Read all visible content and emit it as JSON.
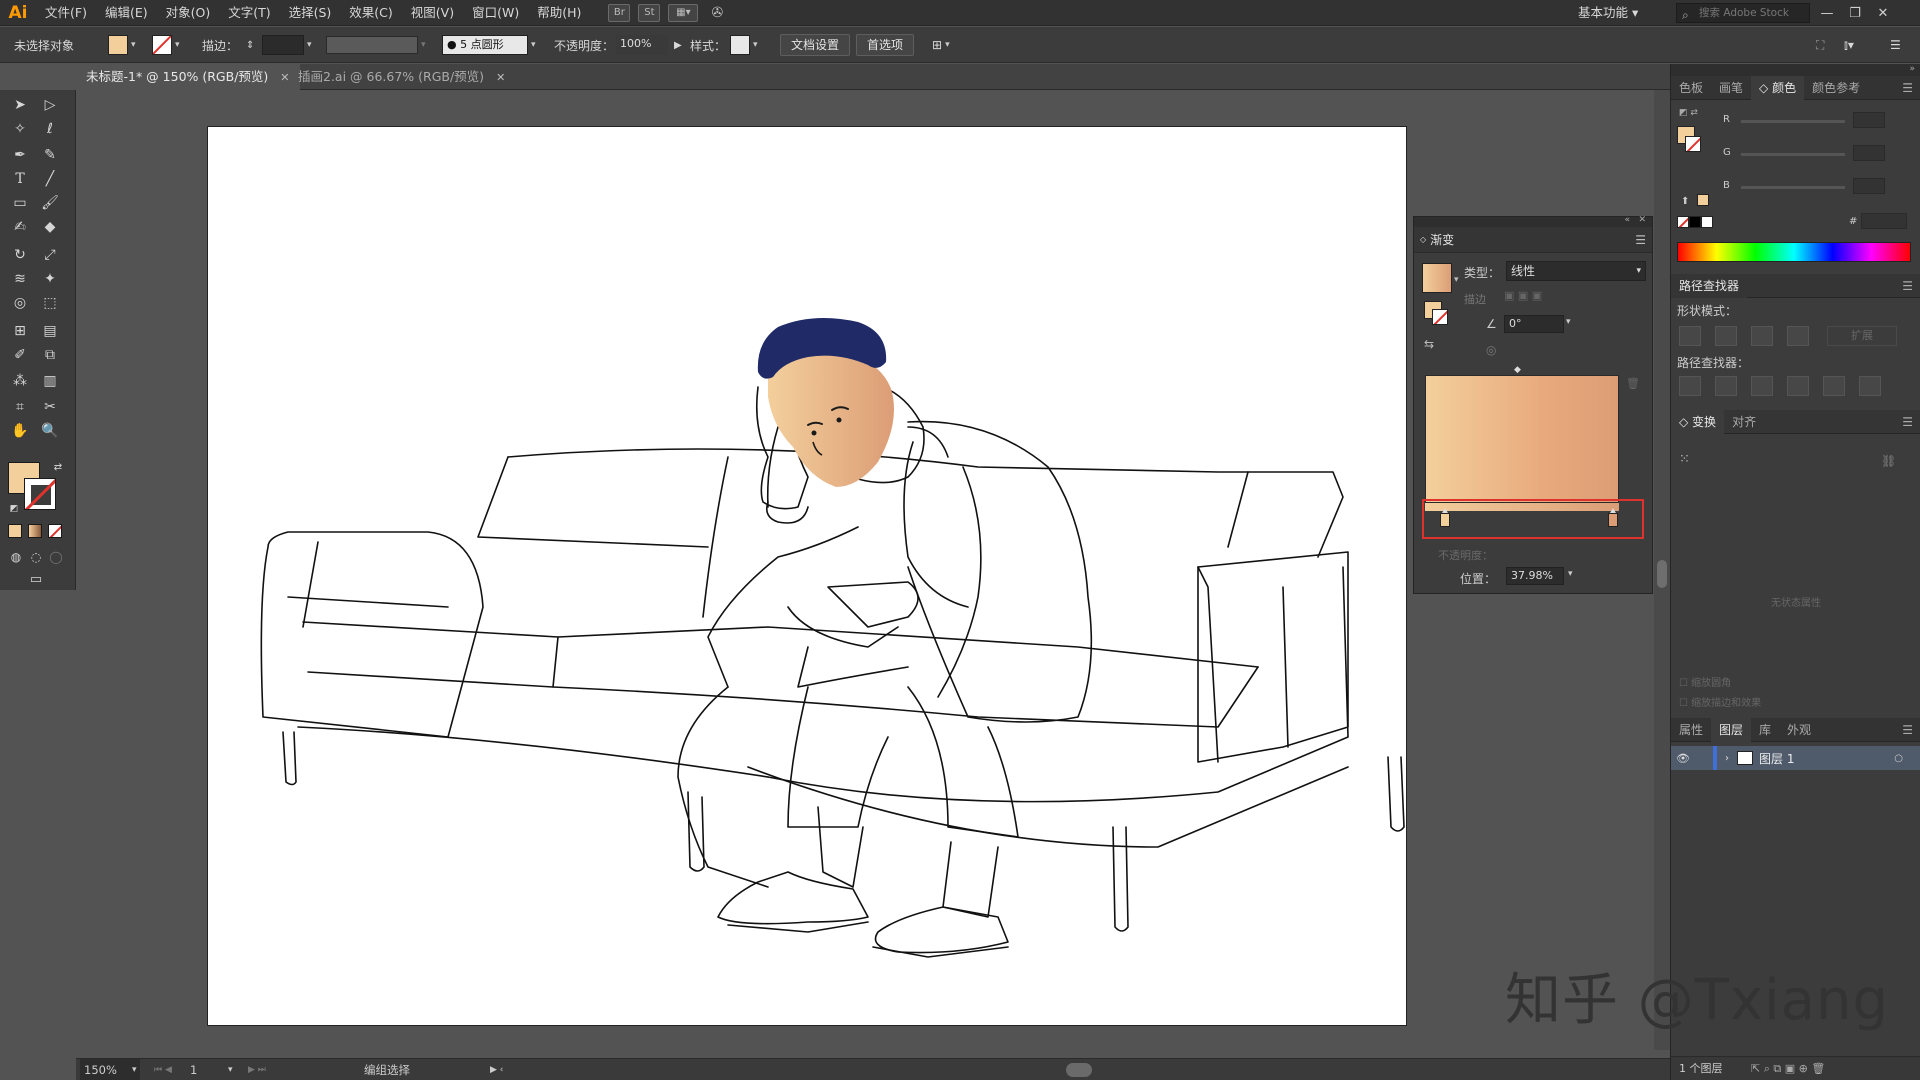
{
  "app": {
    "logo": "Ai"
  },
  "menu": [
    "文件(F)",
    "编辑(E)",
    "对象(O)",
    "文字(T)",
    "选择(S)",
    "效果(C)",
    "视图(V)",
    "窗口(W)",
    "帮助(H)"
  ],
  "menubar_icons": {
    "bridge": "Br",
    "stock": "St"
  },
  "workspace": "基本功能",
  "search": {
    "placeholder": "搜索 Adobe Stock"
  },
  "controlbar": {
    "selection": "未选择对象",
    "stroke_label": "描边：",
    "brush": "5 点圆形",
    "opacity_label": "不透明度：",
    "opacity_value": "100%",
    "style_label": "样式：",
    "doc_setup": "文档设置",
    "prefs": "首选项"
  },
  "tabs": [
    {
      "label": "未标题-1* @ 150% (RGB/预览)",
      "active": true
    },
    {
      "label": "插画2.ai @ 66.67% (RGB/预览)",
      "active": false
    }
  ],
  "gradient_panel": {
    "title": "渐变",
    "type_label": "类型：",
    "type_value": "线性",
    "stroke_label": "描边",
    "angle_value": "0°",
    "opacity_label": "不透明度：",
    "position_label": "位置：",
    "position_value": "37.98%",
    "start_color": "#f3cf9c",
    "end_color": "#dc9d76"
  },
  "color_panel": {
    "tabs": [
      "色板",
      "画笔",
      "颜色",
      "颜色参考"
    ],
    "channels": [
      "R",
      "G",
      "B"
    ],
    "hex_label": "#"
  },
  "pathfinder": {
    "title": "路径查找器",
    "shape_modes": "形状模式：",
    "expand": "扩展",
    "pathfinders": "路径查找器："
  },
  "transform": {
    "tabs": [
      "变换",
      "对齐"
    ],
    "no_state": "无状态属性",
    "scale_corners": "缩放圆角",
    "scale_strokes": "缩放描边和效果"
  },
  "layers": {
    "tabs": [
      "属性",
      "图层",
      "库",
      "外观"
    ],
    "layer_name": "图层 1",
    "footer": "1 个图层"
  },
  "statusbar": {
    "zoom": "150%",
    "page": "1",
    "mode": "编组选择"
  },
  "watermark": "知乎 @Txiang",
  "colors": {
    "accent": "#f3cf9c",
    "hair": "#1f2a66",
    "highlight": "#e0322c"
  }
}
